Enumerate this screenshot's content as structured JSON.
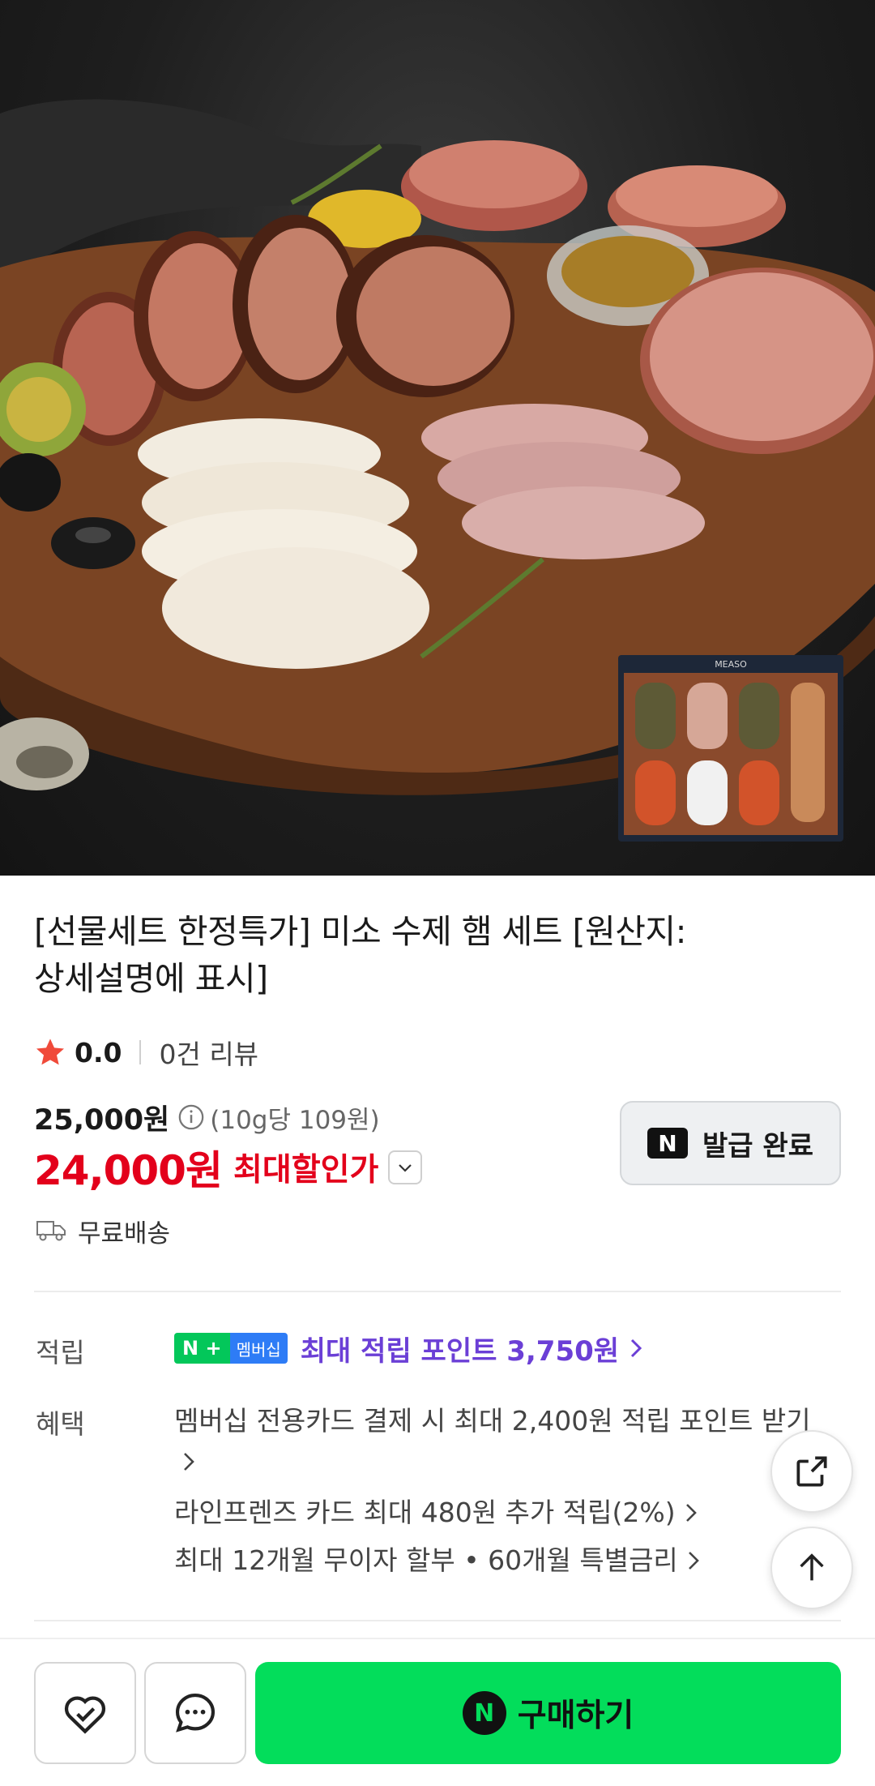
{
  "product": {
    "title_line1": "[선물세트 한정특가] 미소 수제 햄 세트 [원산지:",
    "title_line2": "상세설명에 표시]",
    "rating": "0.0",
    "review_count": "0건 리뷰",
    "original_price": "25,000원",
    "unit_price": "(10g당 109원)",
    "sale_price": "24,000원",
    "sale_label": "최대할인가",
    "shipping": "무료배송",
    "package_brand": "MEASO"
  },
  "coupon": {
    "badge": "N",
    "label": "발급 완료"
  },
  "points": {
    "label": "적립",
    "badge_n": "N +",
    "badge_member": "멤버십",
    "text": "최대 적립 포인트 3,750원"
  },
  "benefits": {
    "label": "혜택",
    "items": [
      "멤버십 전용카드 결제 시 최대 2,400원 적립 포인트 받기",
      "라인프렌즈 카드 최대 480원 추가 적립(2%)",
      "최대 12개월 무이자 할부 • 60개월 특별금리"
    ]
  },
  "bottom": {
    "buy_n": "N",
    "buy_label": "구매하기"
  },
  "colors": {
    "sale": "#e3001b",
    "points": "#6b3fd6",
    "buy": "#03dd5b"
  },
  "icons": [
    "star-icon",
    "info-icon",
    "chevron-down-icon",
    "truck-icon",
    "share-icon",
    "arrow-up-icon",
    "heart-check-icon",
    "chat-icon"
  ]
}
